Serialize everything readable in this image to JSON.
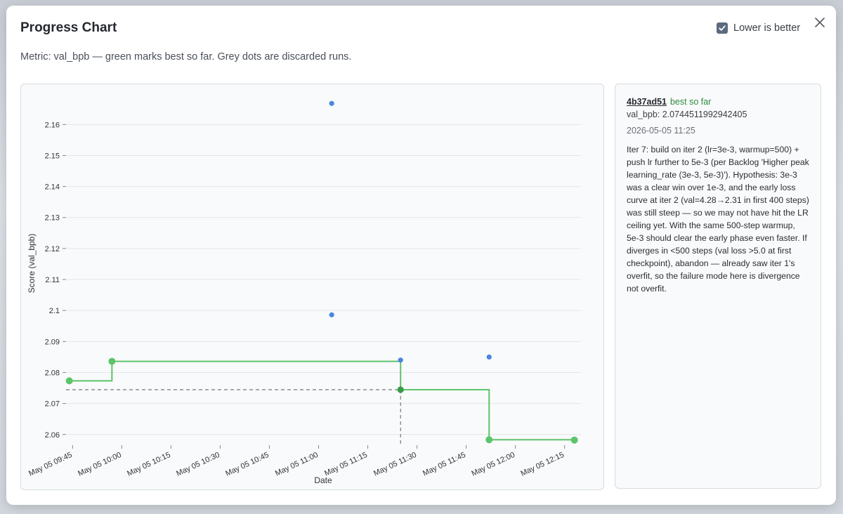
{
  "modal": {
    "title": "Progress Chart",
    "subtitle": "Metric: val_bpb — green marks best so far. Grey dots are discarded runs.",
    "lower_is_better_label": "Lower is better",
    "lower_is_better_checked": true,
    "close_icon": "close-icon"
  },
  "colors": {
    "best": "#5cc46a",
    "best_line": "#5cc46a",
    "discarded": "#4a86e0",
    "grid": "#e3e6ea",
    "dashed": "#777777",
    "selected_point": "#3a9a48"
  },
  "chart_data": {
    "type": "scatter",
    "xlabel": "Date",
    "ylabel": "Score (val_bpb)",
    "x_ticks": [
      "May 05 09:45",
      "May 05 10:00",
      "May 05 10:15",
      "May 05 10:30",
      "May 05 10:45",
      "May 05 11:00",
      "May 05 11:15",
      "May 05 11:30",
      "May 05 11:45",
      "May 05 12:00",
      "May 05 12:15"
    ],
    "y_ticks": [
      "2.06",
      "2.07",
      "2.08",
      "2.09",
      "2.1",
      "2.11",
      "2.12",
      "2.13",
      "2.14",
      "2.15",
      "2.16"
    ],
    "xlim": [
      "2026-05-05 09:43",
      "2026-05-05 12:20"
    ],
    "ylim": [
      2.057,
      2.168
    ],
    "grid": true,
    "series": [
      {
        "name": "best so far",
        "style": "step",
        "points": [
          {
            "x": "2026-05-05 09:44",
            "y": 2.0773
          },
          {
            "x": "2026-05-05 09:57",
            "y": 2.0836
          },
          {
            "x": "2026-05-05 11:25",
            "y": 2.07445
          },
          {
            "x": "2026-05-05 11:52",
            "y": 2.0583
          },
          {
            "x": "2026-05-05 12:18",
            "y": 2.0582
          }
        ]
      },
      {
        "name": "discarded",
        "style": "dots",
        "points": [
          {
            "x": "2026-05-05 11:04",
            "y": 2.1668
          },
          {
            "x": "2026-05-05 11:04",
            "y": 2.0986
          },
          {
            "x": "2026-05-05 11:25",
            "y": 2.084
          },
          {
            "x": "2026-05-05 11:52",
            "y": 2.085
          }
        ]
      }
    ],
    "selected_point": {
      "x": "2026-05-05 11:25",
      "y": 2.07445
    }
  },
  "detail": {
    "run_id": "4b37ad51",
    "tag": "best so far",
    "metric_text": "val_bpb: 2.0744511992942405",
    "date": "2026-05-05 11:25",
    "description": "Iter 7: build on iter 2 (lr=3e-3, warmup=500) + push lr further to 5e-3 (per Backlog 'Higher peak learning_rate (3e-3, 5e-3)'). Hypothesis: 3e-3 was a clear win over 1e-3, and the early loss curve at iter 2 (val=4.28→2.31 in first 400 steps) was still steep — so we may not have hit the LR ceiling yet. With the same 500-step warmup, 5e-3 should clear the early phase even faster. If diverges in <500 steps (val loss >5.0 at first checkpoint), abandon — already saw iter 1's overfit, so the failure mode here is divergence not overfit."
  }
}
